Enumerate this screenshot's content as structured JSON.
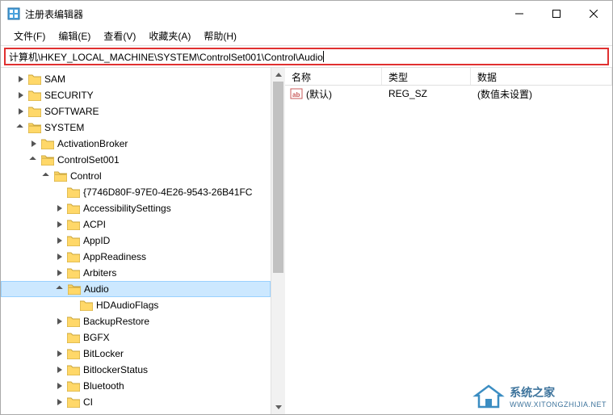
{
  "window": {
    "title": "注册表编辑器"
  },
  "menu": {
    "file": "文件(F)",
    "edit": "编辑(E)",
    "view": "查看(V)",
    "favorites": "收藏夹(A)",
    "help": "帮助(H)"
  },
  "address": {
    "path": "计算机\\HKEY_LOCAL_MACHINE\\SYSTEM\\ControlSet001\\Control\\Audio"
  },
  "tree": {
    "sam": "SAM",
    "security": "SECURITY",
    "software": "SOFTWARE",
    "system": "SYSTEM",
    "activationbroker": "ActivationBroker",
    "controlset001": "ControlSet001",
    "control": "Control",
    "guid": "{7746D80F-97E0-4E26-9543-26B41FC",
    "accessibility": "AccessibilitySettings",
    "acpi": "ACPI",
    "appid": "AppID",
    "appreadiness": "AppReadiness",
    "arbiters": "Arbiters",
    "audio": "Audio",
    "hdaudioflags": "HDAudioFlags",
    "backuprestore": "BackupRestore",
    "bgfx": "BGFX",
    "bitlocker": "BitLocker",
    "bitlockerstatus": "BitlockerStatus",
    "bluetooth": "Bluetooth",
    "ci": "CI"
  },
  "list": {
    "col_name": "名称",
    "col_type": "类型",
    "col_data": "数据",
    "default_name": "(默认)",
    "default_type": "REG_SZ",
    "default_data": "(数值未设置)"
  },
  "watermark": {
    "title": "系统之家",
    "url": "WWW.XITONGZHIJIA.NET"
  }
}
